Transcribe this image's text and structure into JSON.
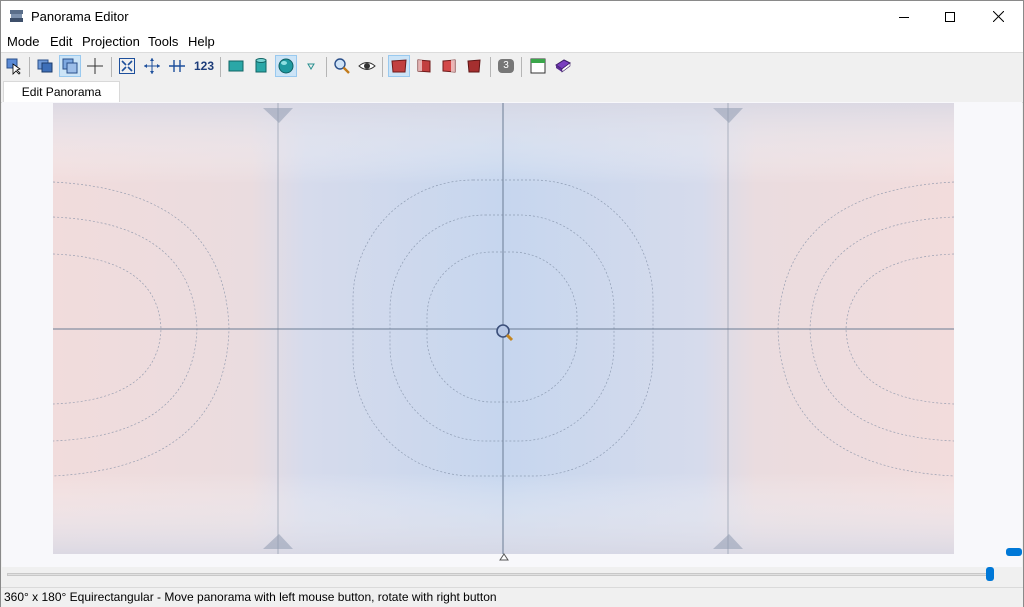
{
  "window": {
    "title": "Panorama Editor"
  },
  "menu": [
    "Mode",
    "Edit",
    "Projection",
    "Tools",
    "Help"
  ],
  "toolbar": {
    "items": [
      {
        "name": "select-pointer-icon"
      },
      {
        "name": "images-icon"
      },
      {
        "name": "mask-icon",
        "active": true
      },
      {
        "name": "crop-icon"
      },
      {
        "name": "fit-icon"
      },
      {
        "name": "center-icon"
      },
      {
        "name": "straighten-icon"
      },
      {
        "name": "numeric-transform-icon",
        "label": "123"
      },
      {
        "name": "rectilinear-icon"
      },
      {
        "name": "cylindrical-icon"
      },
      {
        "name": "spherical-icon",
        "active": true
      },
      {
        "name": "projection-dropdown-icon"
      },
      {
        "name": "zoom-icon"
      },
      {
        "name": "preview-eye-icon"
      },
      {
        "name": "layer-1-icon",
        "active": true
      },
      {
        "name": "layer-2-icon"
      },
      {
        "name": "layer-3-icon"
      },
      {
        "name": "layer-4-icon"
      },
      {
        "name": "overlap-count-icon",
        "label": "3"
      },
      {
        "name": "window-icon"
      },
      {
        "name": "book-icon"
      }
    ]
  },
  "tabs": [
    {
      "label": "Edit Panorama",
      "active": true
    }
  ],
  "status": {
    "text": "360° x 180° Equirectangular - Move panorama with left mouse button, rotate with right button"
  },
  "colors": {
    "pano_blue": "#c6d6ee",
    "pano_pink": "#f1dcdc",
    "accent": "#0078d7",
    "guide_line": "#6b7c94"
  }
}
